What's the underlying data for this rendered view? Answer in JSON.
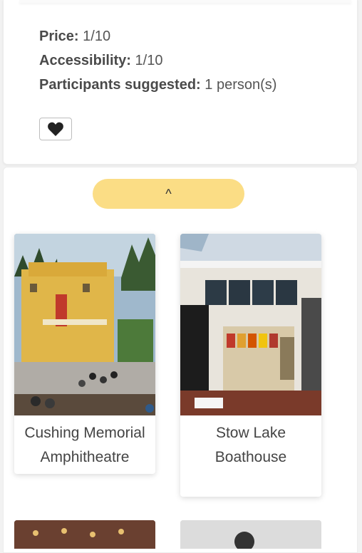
{
  "details": {
    "price_label": "Price:",
    "price_value": "1/10",
    "accessibility_label": "Accessibility:",
    "accessibility_value": "1/10",
    "participants_label": "Participants suggested:",
    "participants_value": "1 person(s)"
  },
  "favorite_icon": "heart-icon",
  "scroll_up_label": "^",
  "places": [
    {
      "name": "Cushing Memorial Amphitheatre"
    },
    {
      "name": "Stow Lake Boathouse"
    }
  ],
  "colors": {
    "scroll_button": "#fbdd85",
    "background": "#f2f2f2"
  }
}
